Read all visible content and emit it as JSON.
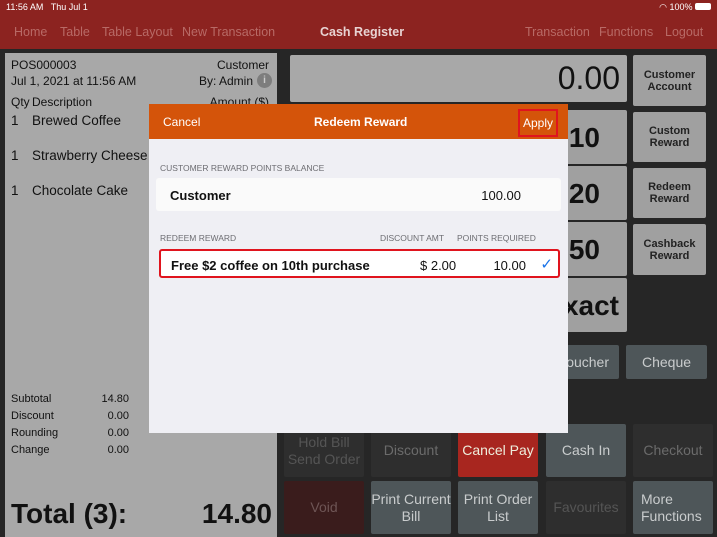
{
  "status": {
    "time": "11:56 AM",
    "date": "Thu Jul 1",
    "battery": "100%"
  },
  "nav": {
    "left": [
      "Home",
      "Table",
      "Table Layout",
      "New Transaction"
    ],
    "title": "Cash Register",
    "right": [
      "Transaction",
      "Functions",
      "Logout"
    ]
  },
  "order": {
    "id": "POS000003",
    "customer": "Customer",
    "datetime": "Jul 1, 2021 at 11:56 AM",
    "by": "By: Admin",
    "col_qty": "Qty",
    "col_desc": "Description",
    "col_amount": "Amount ($)",
    "items": [
      {
        "qty": "1",
        "desc": "Brewed Coffee"
      },
      {
        "qty": "1",
        "desc": "Strawberry Cheese"
      },
      {
        "qty": "1",
        "desc": "Chocolate Cake"
      }
    ],
    "summary": [
      {
        "label": "Subtotal",
        "value": "14.80"
      },
      {
        "label": "Discount",
        "value": "0.00"
      },
      {
        "label": "Rounding",
        "value": "0.00"
      },
      {
        "label": "Change",
        "value": "0.00"
      }
    ],
    "total_label": "Total (3):",
    "total_value": "14.80"
  },
  "display": "0.00",
  "side_buttons": [
    "Customer Account",
    "Custom Reward",
    "Redeem Reward",
    "Cashback Reward"
  ],
  "cash_buttons": [
    "10",
    "20",
    "50",
    "Exact"
  ],
  "pay_buttons": [
    "Voucher",
    "Cheque"
  ],
  "bottom_row1": [
    "Hold Bill Send Order",
    "Discount",
    "Cancel Pay",
    "Cash In",
    "Checkout"
  ],
  "bottom_row2": [
    "Void",
    "Print Current Bill",
    "Print Order List",
    "Favourites",
    "More Functions"
  ],
  "modal": {
    "cancel": "Cancel",
    "title": "Redeem Reward",
    "apply": "Apply",
    "balance_header": "CUSTOMER REWARD POINTS BALANCE",
    "customer": "Customer",
    "points": "100.00",
    "redeem_header": "REDEEM REWARD",
    "discount_header": "DISCOUNT AMT",
    "points_header": "POINTS REQUIRED",
    "rewards": [
      {
        "name": "Free $2 coffee on 10th purchase",
        "discount": "$ 2.00",
        "points": "10.00",
        "selected": true
      }
    ]
  },
  "colors": {
    "nav": "#8c2320",
    "modal_header": "#d4540a",
    "highlight": "#e0141e",
    "check": "#1a73e8"
  }
}
